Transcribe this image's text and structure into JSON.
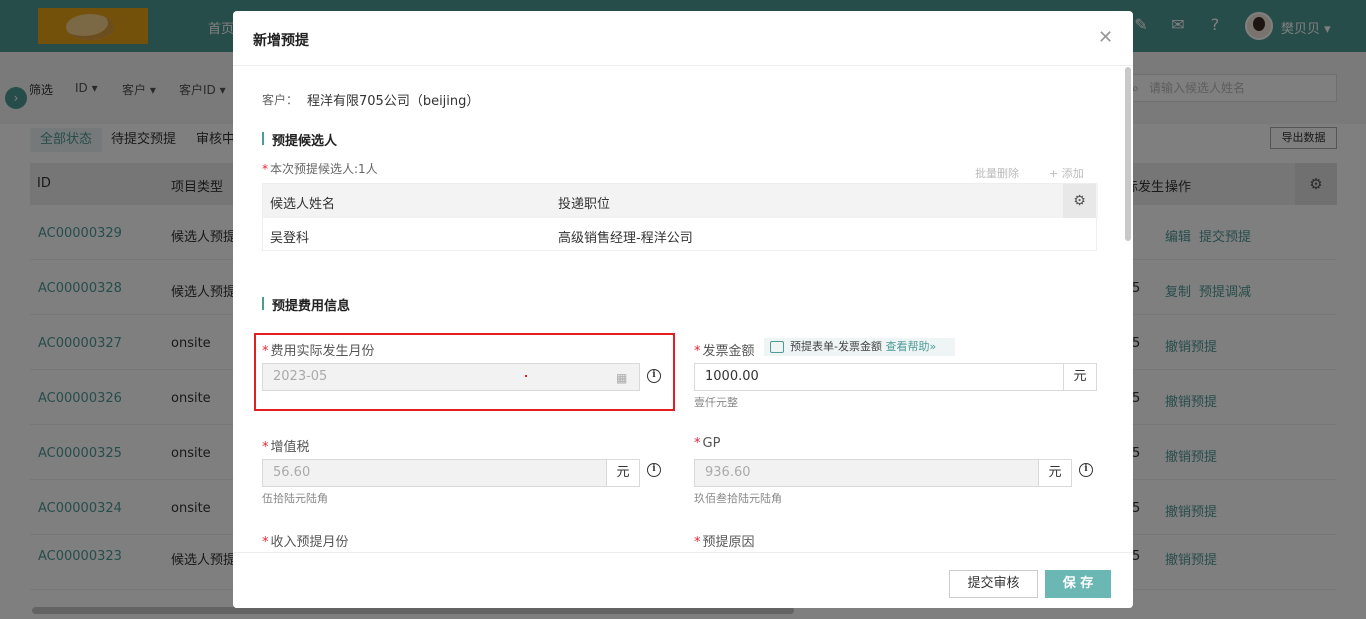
{
  "app": {
    "nav_home": "首页",
    "user_name": "樊贝贝",
    "user_caret": "▾"
  },
  "filters": {
    "label": "筛选",
    "items": [
      "ID ▾",
      "客户 ▾",
      "客户ID ▾"
    ],
    "search_placeholder": "请输入候选人姓名"
  },
  "status_tabs": [
    "全部状态",
    "待提交预提",
    "审核中"
  ],
  "export_label": "导出数据",
  "table": {
    "headers": {
      "id": "ID",
      "type": "项目类型",
      "date_trunc": "际发生",
      "ops": "操作"
    },
    "rows": [
      {
        "id": "AC00000329",
        "type": "候选人预提",
        "trunc": "",
        "actions": [
          "编辑",
          "提交预提"
        ]
      },
      {
        "id": "AC00000328",
        "type": "候选人预提",
        "trunc": "5",
        "actions": [
          "复制",
          "预提调减"
        ]
      },
      {
        "id": "AC00000327",
        "type": "onsite",
        "trunc": "5",
        "actions": [
          "撤销预提"
        ]
      },
      {
        "id": "AC00000326",
        "type": "onsite",
        "trunc": "5",
        "actions": [
          "撤销预提"
        ]
      },
      {
        "id": "AC00000325",
        "type": "onsite",
        "trunc": "5",
        "actions": [
          "撤销预提"
        ]
      },
      {
        "id": "AC00000324",
        "type": "onsite",
        "trunc": "5",
        "actions": [
          "撤销预提"
        ]
      },
      {
        "id": "AC00000323",
        "type": "候选人预提",
        "trunc": "5",
        "actions": [
          "撤销预提"
        ]
      }
    ]
  },
  "modal": {
    "title": "新增预提",
    "customer_label": "客户：",
    "customer_value": "程洋有限705公司（beijing）",
    "section_candidates": "预提候选人",
    "candidates_count": "本次预提候选人:1人",
    "batch_delete": "批量删除",
    "add": "+ 添加",
    "cand_headers": [
      "候选人姓名",
      "投递职位"
    ],
    "candidates": [
      {
        "name": "吴登科",
        "position": "高级销售经理-程洋公司"
      }
    ],
    "section_fee": "预提费用信息",
    "fee_month_label": "费用实际发生月份",
    "fee_month_value": "2023-05",
    "invoice_label": "发票金额",
    "help_text": "预提表单-发票金额",
    "help_link": "查看帮助»",
    "invoice_value": "1000.00",
    "invoice_hint": "壹仟元整",
    "unit": "元",
    "vat_label": "增值税",
    "vat_value": "56.60",
    "vat_hint": "伍拾陆元陆角",
    "gp_label": "GP",
    "gp_value": "936.60",
    "gp_hint": "玖佰叁拾陆元陆角",
    "income_month_label": "收入预提月份",
    "reason_label": "预提原因",
    "submit_button": "提交审核",
    "save_button": "保 存",
    "req_mark": "*"
  },
  "colors": {
    "brand": "#4e9a97",
    "highlight_border": "#e41e1e"
  }
}
